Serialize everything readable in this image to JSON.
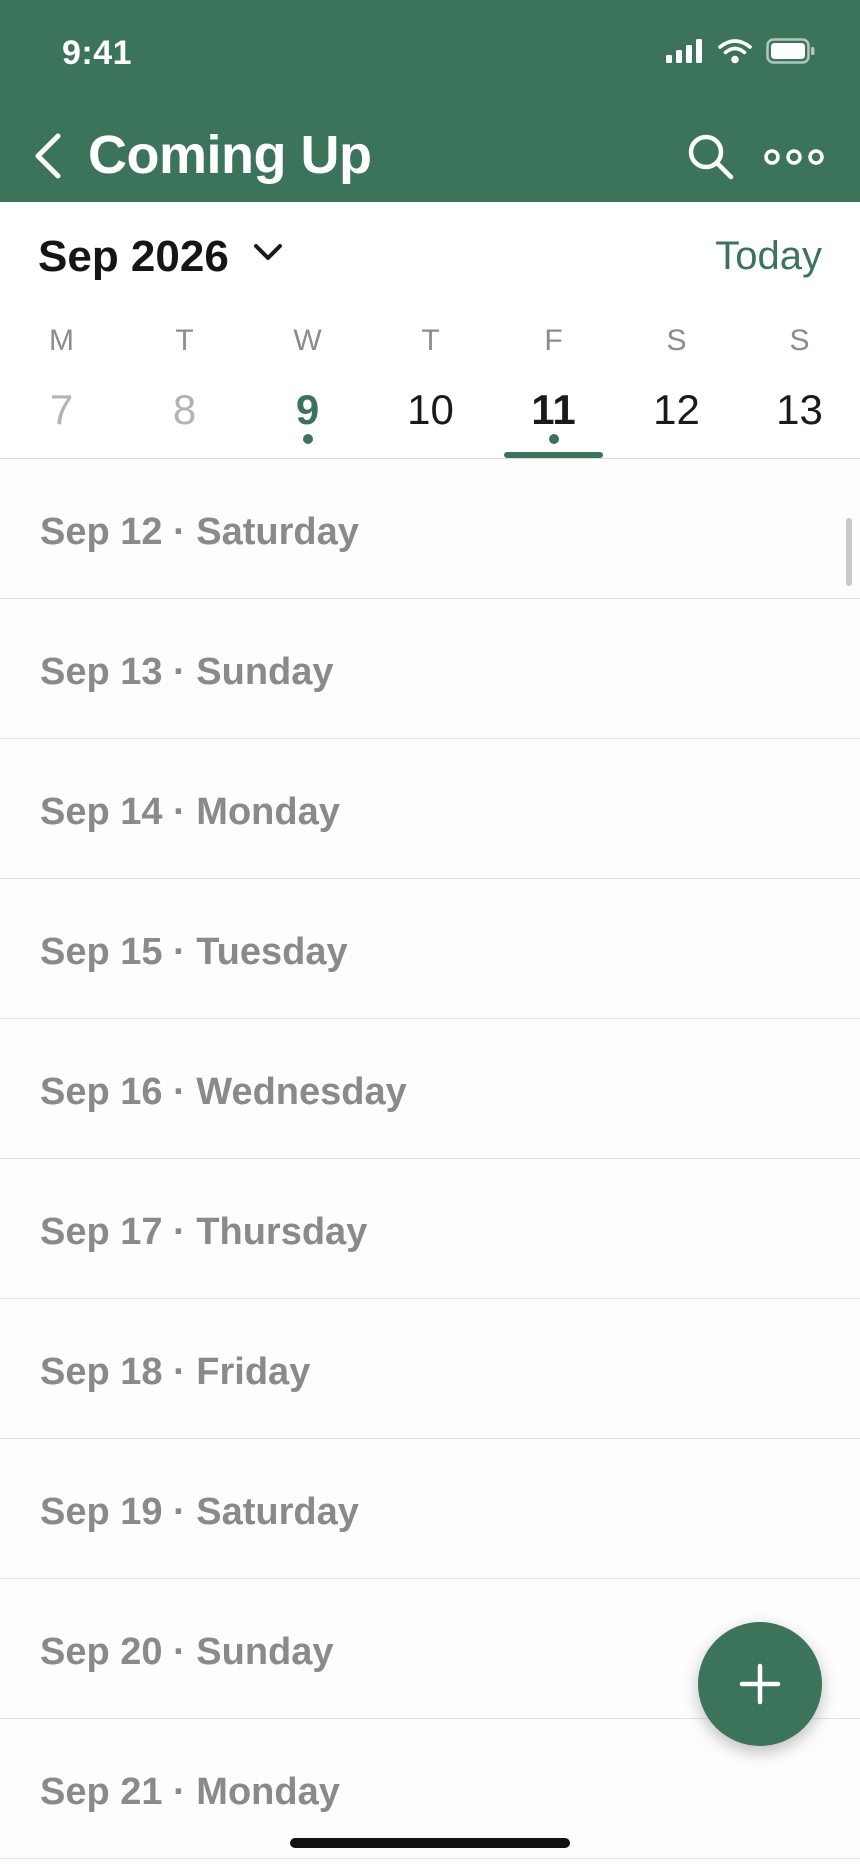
{
  "status": {
    "time": "9:41"
  },
  "nav": {
    "title": "Coming Up"
  },
  "calendar": {
    "month_label": "Sep 2026",
    "today_label": "Today",
    "days": [
      {
        "letter": "M",
        "num": "7"
      },
      {
        "letter": "T",
        "num": "8"
      },
      {
        "letter": "W",
        "num": "9"
      },
      {
        "letter": "T",
        "num": "10"
      },
      {
        "letter": "F",
        "num": "11"
      },
      {
        "letter": "S",
        "num": "12"
      },
      {
        "letter": "S",
        "num": "13"
      }
    ]
  },
  "list": {
    "items": [
      "Sep 12 · Saturday",
      "Sep 13 · Sunday",
      "Sep 14 · Monday",
      "Sep 15 · Tuesday",
      "Sep 16 · Wednesday",
      "Sep 17 · Thursday",
      "Sep 18 · Friday",
      "Sep 19 · Saturday",
      "Sep 20 · Sunday",
      "Sep 21 · Monday"
    ]
  },
  "colors": {
    "accent": "#3c735b",
    "muted_text": "#8a8a8a"
  },
  "icons": [
    "signal-icon",
    "wifi-icon",
    "battery-icon",
    "chevron-left-icon",
    "search-icon",
    "more-icon",
    "chevron-down-icon",
    "plus-icon"
  ]
}
